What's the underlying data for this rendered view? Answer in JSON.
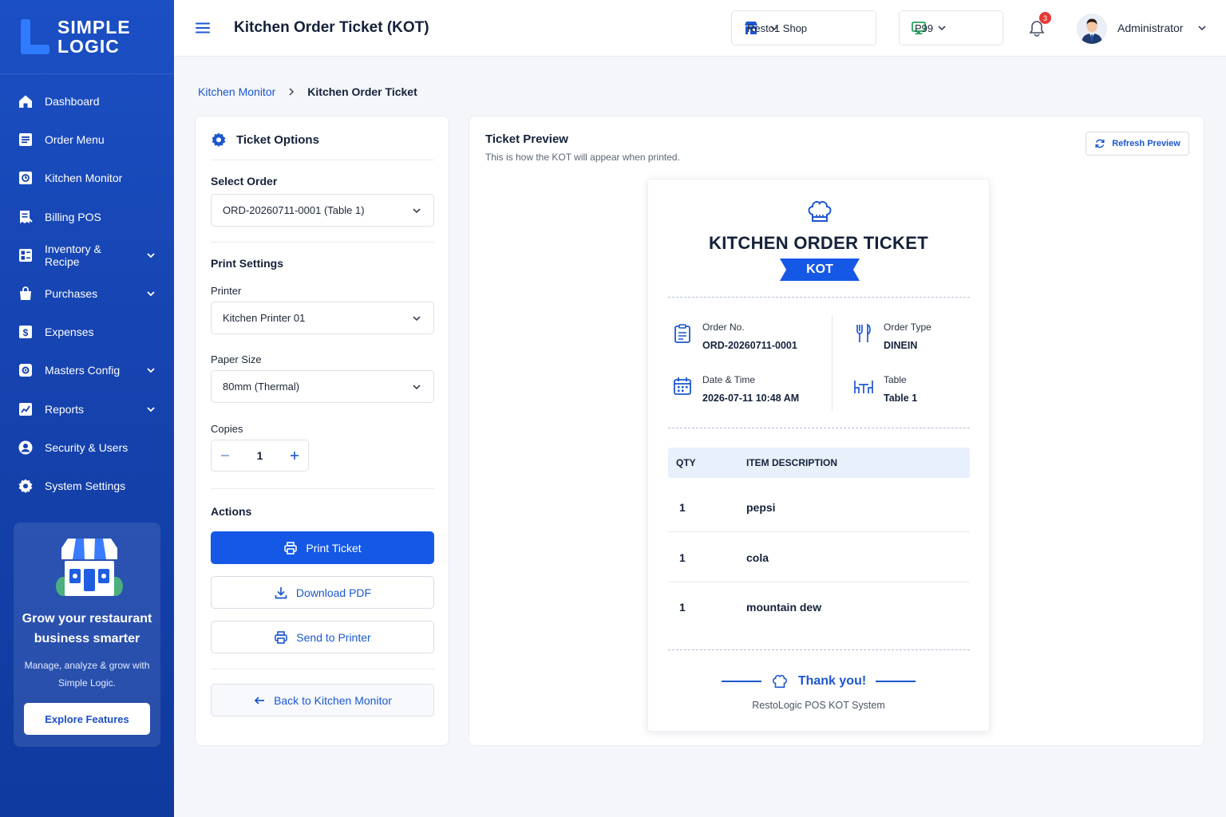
{
  "brand": {
    "line1": "SIMPLE",
    "line2": "LOGIC"
  },
  "sidebar": {
    "items": [
      {
        "label": "Dashboard",
        "icon": "home-icon",
        "chevron": false
      },
      {
        "label": "Order Menu",
        "icon": "menu-list-icon",
        "chevron": false
      },
      {
        "label": "Kitchen Monitor",
        "icon": "monitor-icon",
        "chevron": false
      },
      {
        "label": "Billing POS",
        "icon": "receipt-icon",
        "chevron": false
      },
      {
        "label": "Inventory & Recipe",
        "icon": "inventory-icon",
        "chevron": true
      },
      {
        "label": "Purchases",
        "icon": "bag-icon",
        "chevron": true
      },
      {
        "label": "Expenses",
        "icon": "dollar-icon",
        "chevron": false
      },
      {
        "label": "Masters Config",
        "icon": "config-icon",
        "chevron": true
      },
      {
        "label": "Reports",
        "icon": "chart-icon",
        "chevron": true
      },
      {
        "label": "Security & Users",
        "icon": "user-icon",
        "chevron": false
      },
      {
        "label": "System Settings",
        "icon": "gear-icon",
        "chevron": false
      }
    ]
  },
  "promo": {
    "title": "Grow your restaurant business smarter",
    "subtitle": "Manage, analyze & grow with Simple Logic.",
    "button": "Explore Features"
  },
  "header": {
    "title": "Kitchen Order Ticket (KOT)",
    "shop": "Resto1 Shop",
    "terminal": "P99",
    "notifications": "3",
    "user": "Administrator"
  },
  "breadcrumb": {
    "parent": "Kitchen Monitor",
    "current": "Kitchen Order Ticket"
  },
  "options": {
    "title": "Ticket Options",
    "select_order_label": "Select Order",
    "order_value": "ORD-20260711-0001 (Table 1)",
    "print_settings_label": "Print Settings",
    "printer_label": "Printer",
    "printer_value": "Kitchen Printer 01",
    "paper_label": "Paper Size",
    "paper_value": "80mm (Thermal)",
    "copies_label": "Copies",
    "copies_value": "1",
    "actions_label": "Actions",
    "print_button": "Print Ticket",
    "download_button": "Download PDF",
    "send_button": "Send to Printer",
    "back_button": "Back to Kitchen Monitor"
  },
  "preview": {
    "title": "Ticket Preview",
    "subtitle": "This is how the KOT will appear when printed.",
    "refresh_button": "Refresh Preview"
  },
  "ticket": {
    "title": "KITCHEN ORDER TICKET",
    "badge": "KOT",
    "order_no_label": "Order No.",
    "order_no": "ORD-20260711-0001",
    "order_type_label": "Order Type",
    "order_type": "DINEIN",
    "datetime_label": "Date & Time",
    "datetime": "2026-07-11 10:48 AM",
    "table_label": "Table",
    "table": "Table 1",
    "col_qty": "QTY",
    "col_desc": "ITEM DESCRIPTION",
    "items": [
      {
        "qty": "1",
        "desc": "pepsi"
      },
      {
        "qty": "1",
        "desc": "cola"
      },
      {
        "qty": "1",
        "desc": "mountain dew"
      }
    ],
    "thanks": "Thank you!",
    "footer": "RestoLogic POS KOT System"
  },
  "colors": {
    "primary": "#1558e6",
    "sidebar": "#1542ad",
    "accent_light": "#e8f0fc"
  }
}
